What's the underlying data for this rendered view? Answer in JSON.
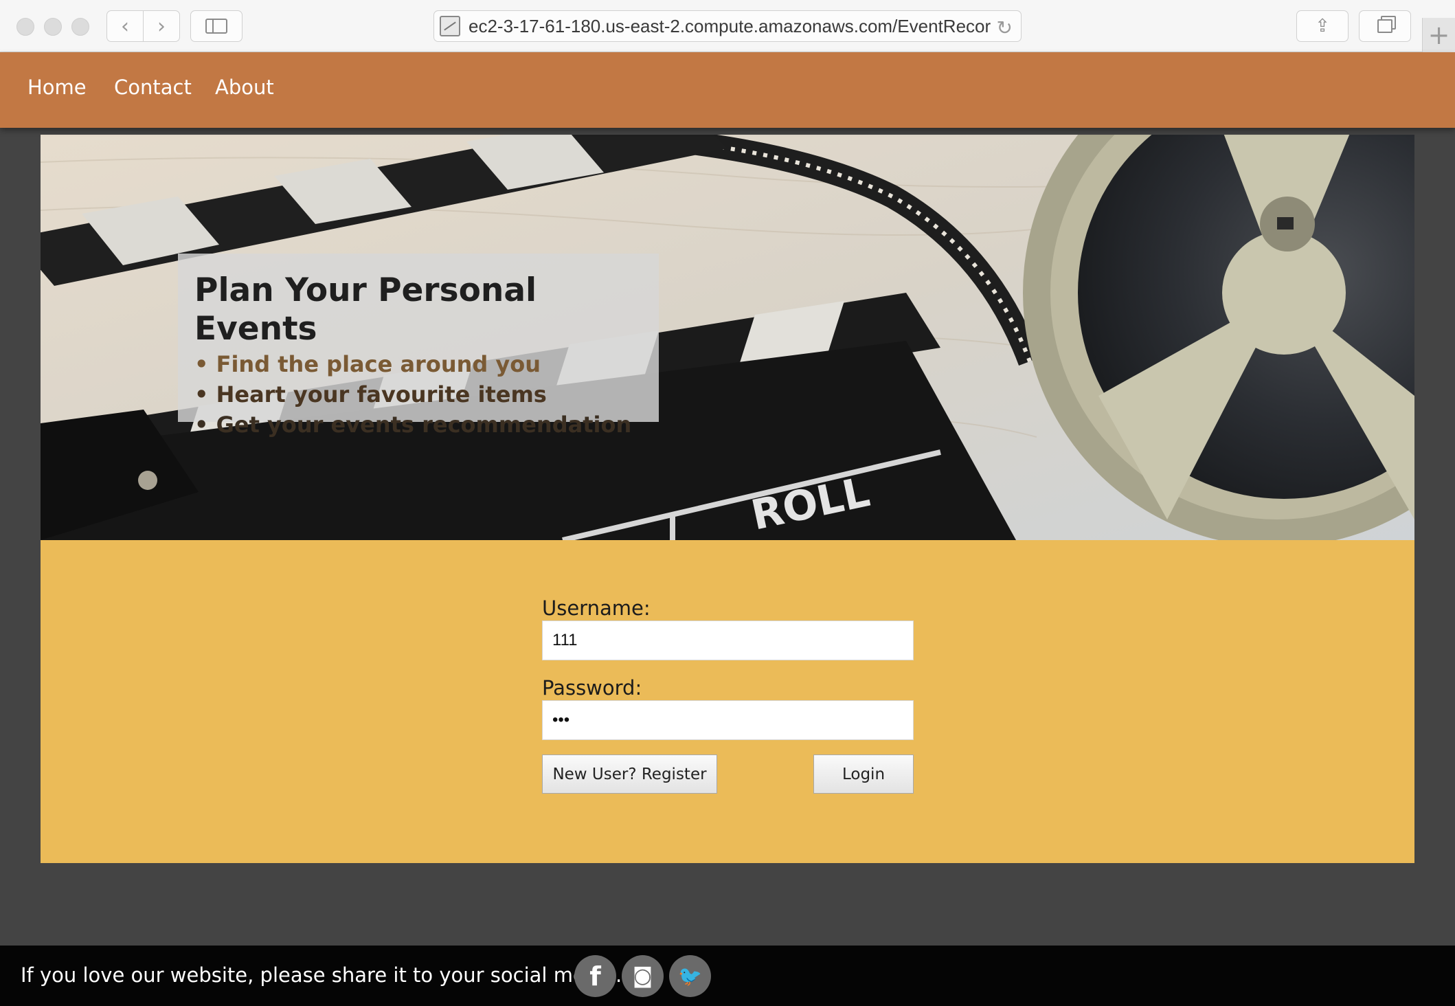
{
  "browser": {
    "url": "ec2-3-17-61-180.us-east-2.compute.amazonaws.com/EventRecor"
  },
  "nav": {
    "items": [
      {
        "label": "Home"
      },
      {
        "label": "Contact"
      },
      {
        "label": "About"
      }
    ]
  },
  "hero": {
    "title": "Plan Your Personal Events",
    "items": [
      {
        "text": "• Find the place around you"
      },
      {
        "text": "• Heart your favourite items"
      },
      {
        "text": "• Get your events recommendation"
      }
    ],
    "reel_label": "ROLL"
  },
  "login": {
    "username_label": "Username:",
    "username_value": "111",
    "password_label": "Password:",
    "password_value": "111",
    "register_label": "New User? Register",
    "login_label": "Login"
  },
  "footer": {
    "text": "If you love our website, please share it to your social media.",
    "social": [
      {
        "icon": "facebook-icon",
        "glyph": "f"
      },
      {
        "icon": "instagram-icon",
        "glyph": "◙"
      },
      {
        "icon": "twitter-icon",
        "glyph": "🐦"
      }
    ]
  },
  "colors": {
    "nav_bg": "#c27844",
    "login_bg": "#ebbb58",
    "page_bg": "#444444",
    "footer_bg": "#050505"
  }
}
